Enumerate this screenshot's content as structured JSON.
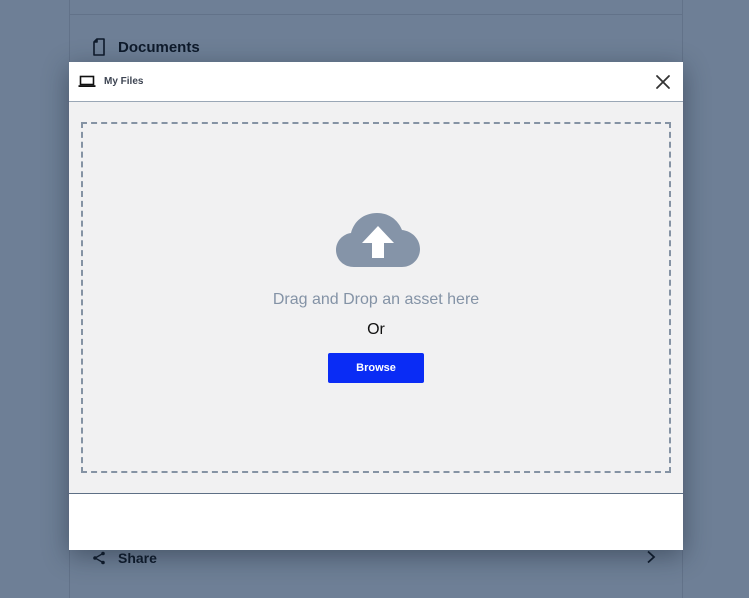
{
  "background": {
    "documents_label": "Documents",
    "documents_icon": "document-icon",
    "share_label": "Share",
    "share_icon": "share-icon",
    "chevron_icon": "chevron-right-icon"
  },
  "modal": {
    "title": "My Files",
    "title_icon": "laptop-icon",
    "close_icon": "close-icon",
    "upload_icon": "cloud-upload-icon",
    "drop_text": "Drag and Drop an asset here",
    "or_text": "Or",
    "browse_label": "Browse"
  },
  "colors": {
    "overlay": "#6e7f96",
    "accent": "#0a2cf5",
    "drop_zone_bg": "#f1f1f2",
    "cloud": "#8594a8"
  }
}
